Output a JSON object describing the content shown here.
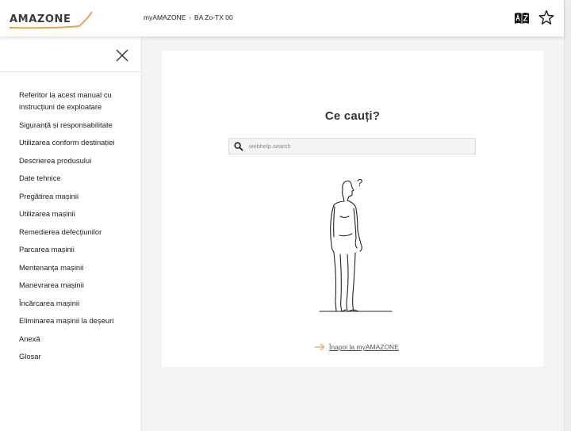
{
  "header": {
    "logo_text": "AMAZONE",
    "breadcrumb": [
      {
        "label": "myAMAZONE"
      },
      {
        "label": "BA Zo-TX 00"
      }
    ],
    "breadcrumb_separator": "›",
    "icons": [
      "glossary-icon",
      "star-icon"
    ]
  },
  "sidebar": {
    "close_icon": "close-icon",
    "items": [
      {
        "label": "Referitor la acest manual cu instrucțiuni de exploatare"
      },
      {
        "label": "Siguranță și responsabilitate"
      },
      {
        "label": "Utilizarea conform destinației"
      },
      {
        "label": "Descrierea produsului"
      },
      {
        "label": "Date tehnice"
      },
      {
        "label": "Pregătirea mașinii"
      },
      {
        "label": "Utilizarea mașinii"
      },
      {
        "label": "Remedierea defecțiunilor"
      },
      {
        "label": "Parcarea mașinii"
      },
      {
        "label": "Mentenanța mașinii"
      },
      {
        "label": "Manevrarea mașinii"
      },
      {
        "label": "Încărcarea mașinii"
      },
      {
        "label": "Eliminarea mașinii la deșeuri"
      },
      {
        "label": "Anexă"
      },
      {
        "label": "Glosar"
      }
    ]
  },
  "main": {
    "title": "Ce cauți?",
    "search": {
      "placeholder": "webhelp.search",
      "value": ""
    },
    "illustration": "person-question-illustration",
    "illustration_text": "?",
    "back_link": "Înapoi la myAMAZONE"
  },
  "colors": {
    "accent": "#e8a44a",
    "background": "#f4f4f4",
    "text": "#222222"
  }
}
